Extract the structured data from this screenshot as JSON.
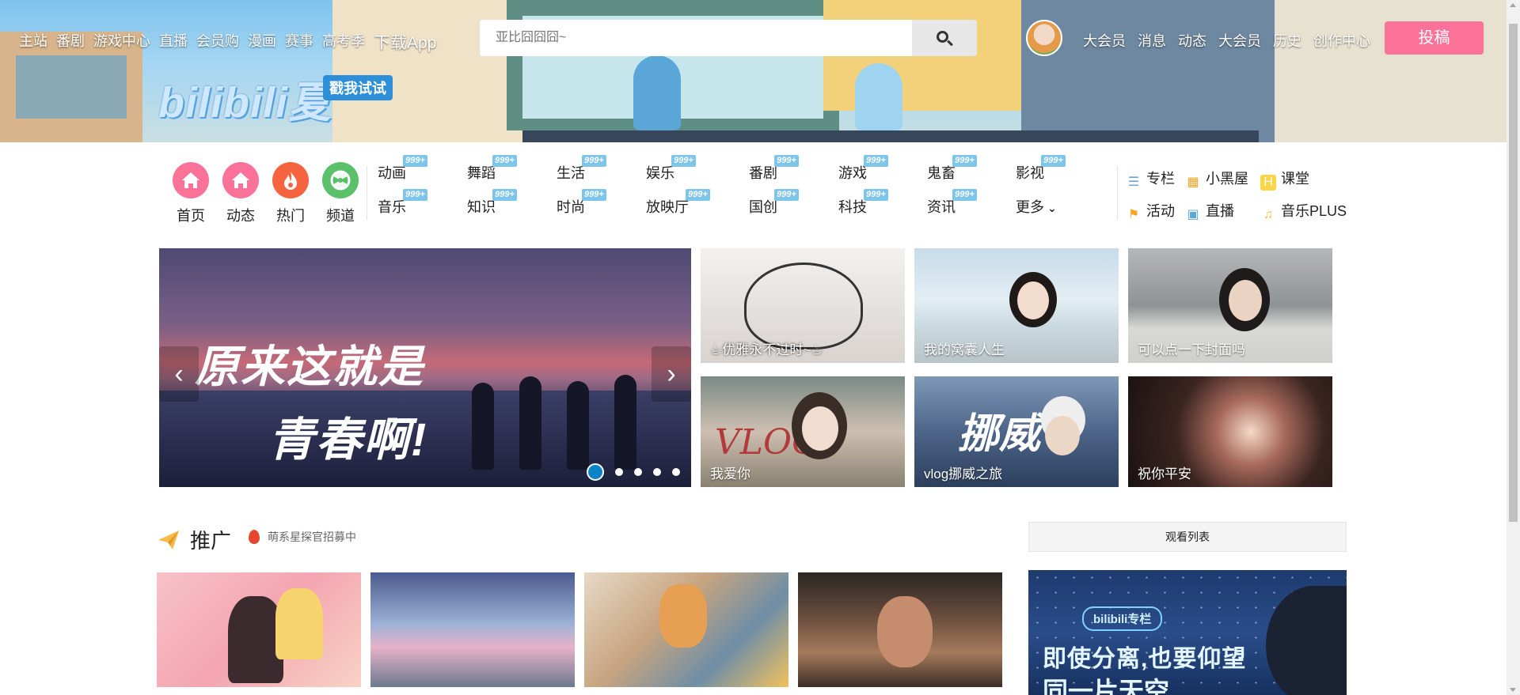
{
  "nav": {
    "left_links": [
      "主站",
      "番剧",
      "游戏中心",
      "直播",
      "会员购",
      "漫画",
      "赛事",
      "高考季"
    ],
    "download_app": "下载App",
    "search_placeholder": "亚比囧囧囧~",
    "right_links": [
      "大会员",
      "消息",
      "动态",
      "大会员",
      "历史",
      "创作中心"
    ],
    "upload_label": "投稿"
  },
  "banner": {
    "logo_text": "bilibili夏",
    "try_me": "戳我试试"
  },
  "quick_icons": [
    {
      "label": "首页",
      "color": "#fb7299",
      "icon": "home-icon"
    },
    {
      "label": "动态",
      "color": "#fb7299",
      "icon": "home-icon"
    },
    {
      "label": "热门",
      "color": "#f5633f",
      "icon": "flame-icon"
    },
    {
      "label": "频道",
      "color": "#5ac06a",
      "icon": "channel-icon"
    }
  ],
  "categories": {
    "badge": "999+",
    "row1": [
      "动画",
      "舞蹈",
      "生活",
      "娱乐",
      "番剧",
      "游戏",
      "鬼畜",
      "影视"
    ],
    "row2": [
      "音乐",
      "知识",
      "时尚",
      "放映厅",
      "国创",
      "科技",
      "资讯"
    ],
    "more_label": "更多"
  },
  "extras": {
    "row1": [
      {
        "label": "专栏",
        "icon": "column-icon"
      },
      {
        "label": "小黑屋",
        "icon": "blackroom-icon"
      },
      {
        "label": "课堂",
        "icon": "classroom-icon"
      }
    ],
    "row2": [
      {
        "label": "活动",
        "icon": "flag-icon"
      },
      {
        "label": "直播",
        "icon": "camera-icon"
      },
      {
        "label": "音乐PLUS",
        "icon": "music-note-icon"
      }
    ]
  },
  "carousel": {
    "line1": "原来这就是",
    "line2": "青春啊!",
    "prev": "‹",
    "next": "›"
  },
  "thumbs": [
    "☕优雅永不过时~☕",
    "我的窝囊人生",
    "可以点一下封面吗",
    "我爱你",
    "vlog挪威之旅",
    "祝你平安"
  ],
  "thumb_decor": {
    "vlog_text": "VLOG",
    "norway_text": "挪威"
  },
  "promo": {
    "title": "推广",
    "subtitle": "萌系星探官招募中",
    "watch_list": "观看列表"
  },
  "side_ad": {
    "pill": "bilibili专栏",
    "line1": "即使分离,也要仰望",
    "line2": "同一片天空"
  }
}
